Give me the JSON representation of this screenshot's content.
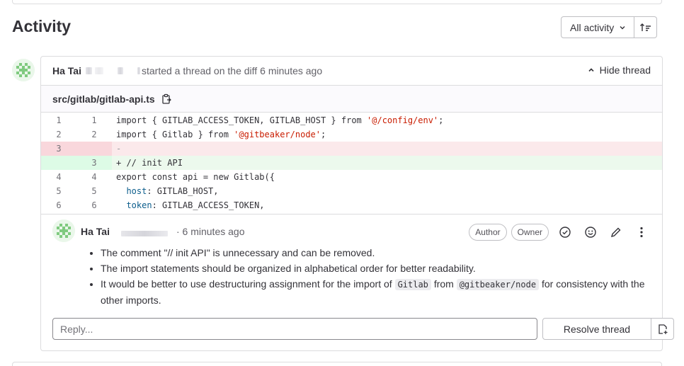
{
  "activity": {
    "title": "Activity"
  },
  "filter": {
    "label": "All activity"
  },
  "thread": {
    "author": "Ha Tai",
    "action": "started a thread on the diff",
    "time": "6 minutes ago",
    "hide_label": "Hide thread",
    "file_path": "src/gitlab/gitlab-api.ts",
    "diff": [
      {
        "old": "1",
        "new": "1",
        "type": "ctx",
        "code": "import { GITLAB_ACCESS_TOKEN, GITLAB_HOST } from '@/config/env';"
      },
      {
        "old": "2",
        "new": "2",
        "type": "ctx",
        "code": "import { Gitlab } from '@gitbeaker/node';"
      },
      {
        "old": "3",
        "new": "",
        "type": "del",
        "code": "-"
      },
      {
        "old": "",
        "new": "3",
        "type": "add",
        "code": "+ // init API"
      },
      {
        "old": "4",
        "new": "4",
        "type": "ctx",
        "code": "export const api = new Gitlab({"
      },
      {
        "old": "5",
        "new": "5",
        "type": "ctx",
        "code": "  host: GITLAB_HOST,"
      },
      {
        "old": "6",
        "new": "6",
        "type": "ctx",
        "code": "  token: GITLAB_ACCESS_TOKEN,"
      }
    ]
  },
  "note": {
    "author": "Ha Tai",
    "time": "· 6 minutes ago",
    "badges": [
      "Author",
      "Owner"
    ],
    "items": [
      "The comment \"// init API\" is unnecessary and can be removed.",
      "The import statements should be organized in alphabetical order for better readability."
    ],
    "item3": {
      "pre": "It would be better to use destructuring assignment for the import of",
      "code1": "Gitlab",
      "mid": "from",
      "code2": "@gitbeaker/node",
      "post": "for consistency with the other imports."
    }
  },
  "reply": {
    "placeholder": "Reply..."
  },
  "resolve": {
    "label": "Resolve thread"
  }
}
